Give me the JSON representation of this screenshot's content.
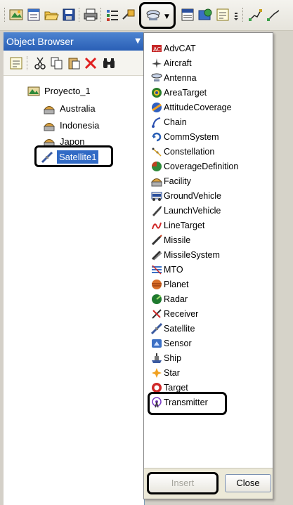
{
  "panel": {
    "title": "Object Browser"
  },
  "tree": {
    "root": "Proyecto_1",
    "children": [
      "Australia",
      "Indonesia",
      "Japon"
    ],
    "selected": "Satellite1"
  },
  "menu": {
    "items": [
      {
        "label": "AdvCAT",
        "icon": "advcat-icon"
      },
      {
        "label": "Aircraft",
        "icon": "aircraft-icon"
      },
      {
        "label": "Antenna",
        "icon": "antenna-icon"
      },
      {
        "label": "AreaTarget",
        "icon": "areatarget-icon"
      },
      {
        "label": "AttitudeCoverage",
        "icon": "attitudecoverage-icon"
      },
      {
        "label": "Chain",
        "icon": "chain-icon"
      },
      {
        "label": "CommSystem",
        "icon": "commsystem-icon"
      },
      {
        "label": "Constellation",
        "icon": "constellation-icon"
      },
      {
        "label": "CoverageDefinition",
        "icon": "coveragedefinition-icon"
      },
      {
        "label": "Facility",
        "icon": "facility-icon"
      },
      {
        "label": "GroundVehicle",
        "icon": "groundvehicle-icon"
      },
      {
        "label": "LaunchVehicle",
        "icon": "launchvehicle-icon"
      },
      {
        "label": "LineTarget",
        "icon": "linetarget-icon"
      },
      {
        "label": "Missile",
        "icon": "missile-icon"
      },
      {
        "label": "MissileSystem",
        "icon": "missilesystem-icon"
      },
      {
        "label": "MTO",
        "icon": "mto-icon"
      },
      {
        "label": "Planet",
        "icon": "planet-icon"
      },
      {
        "label": "Radar",
        "icon": "radar-icon"
      },
      {
        "label": "Receiver",
        "icon": "receiver-icon"
      },
      {
        "label": "Satellite",
        "icon": "satellite-icon"
      },
      {
        "label": "Sensor",
        "icon": "sensor-icon"
      },
      {
        "label": "Ship",
        "icon": "ship-icon"
      },
      {
        "label": "Star",
        "icon": "star-icon"
      },
      {
        "label": "Target",
        "icon": "target-icon"
      },
      {
        "label": "Transmitter",
        "icon": "transmitter-icon"
      }
    ],
    "insert_label": "Insert",
    "close_label": "Close"
  },
  "colors": {
    "header": "#2a5fb5",
    "selection": "#316ac5"
  }
}
